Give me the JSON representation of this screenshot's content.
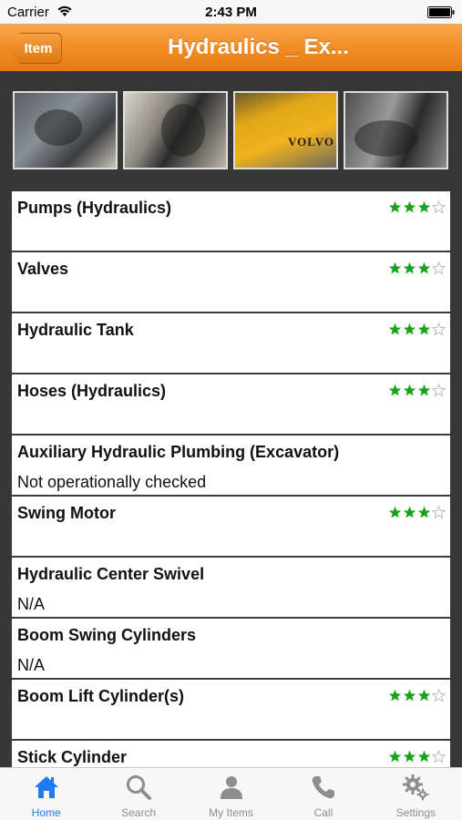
{
  "status_bar": {
    "carrier": "Carrier",
    "time": "2:43 PM"
  },
  "nav": {
    "back_label": "Item",
    "title": "Hydraulics _ Ex..."
  },
  "thumbnails": [
    {
      "icon": "photo-pump"
    },
    {
      "icon": "photo-valves"
    },
    {
      "icon": "photo-boom",
      "text": "VOLVO"
    },
    {
      "icon": "photo-hoses"
    }
  ],
  "items": [
    {
      "title": "Pumps (Hydraulics)",
      "subtitle": "",
      "rating": 3
    },
    {
      "title": "Valves",
      "subtitle": "",
      "rating": 3
    },
    {
      "title": "Hydraulic Tank",
      "subtitle": "",
      "rating": 3
    },
    {
      "title": "Hoses (Hydraulics)",
      "subtitle": "",
      "rating": 3
    },
    {
      "title": "Auxiliary Hydraulic Plumbing (Excavator)",
      "subtitle": "Not operationally checked",
      "rating": 0
    },
    {
      "title": "Swing Motor",
      "subtitle": "",
      "rating": 3
    },
    {
      "title": "Hydraulic Center Swivel",
      "subtitle": "N/A",
      "rating": 0
    },
    {
      "title": "Boom Swing Cylinders",
      "subtitle": "N/A",
      "rating": 0
    },
    {
      "title": "Boom Lift Cylinder(s)",
      "subtitle": "",
      "rating": 3
    },
    {
      "title": "Stick Cylinder",
      "subtitle": "",
      "rating": 3
    }
  ],
  "rating_max": 4,
  "tabs": [
    {
      "label": "Home",
      "icon": "home-icon",
      "active": true
    },
    {
      "label": "Search",
      "icon": "search-icon",
      "active": false
    },
    {
      "label": "My Items",
      "icon": "person-icon",
      "active": false
    },
    {
      "label": "Call",
      "icon": "phone-icon",
      "active": false
    },
    {
      "label": "Settings",
      "icon": "gear-icon",
      "active": false
    }
  ],
  "colors": {
    "accent": "#f08b22",
    "star_on": "#1aa31a",
    "star_off": "#bbbbbb",
    "tab_active": "#1e7cf2",
    "tab_inactive": "#8e8e8e"
  }
}
